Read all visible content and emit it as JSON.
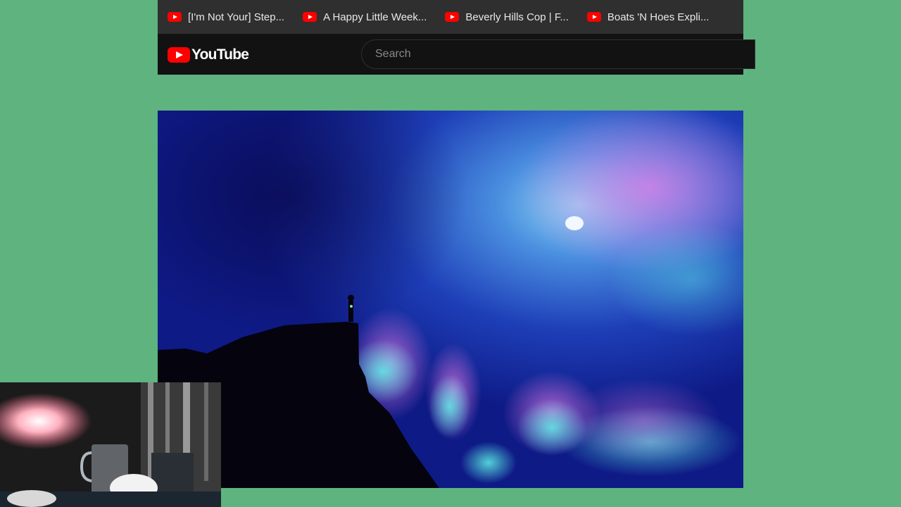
{
  "bookmarks": [
    {
      "label": "[I'm Not Your] Step...",
      "icon": "youtube-icon"
    },
    {
      "label": "A Happy Little Week...",
      "icon": "youtube-icon"
    },
    {
      "label": "Beverly Hills Cop | F...",
      "icon": "youtube-icon"
    },
    {
      "label": "Boats 'N Hoes Expli...",
      "icon": "youtube-icon"
    }
  ],
  "header": {
    "logo_text": "YouTube",
    "search_placeholder": "Search"
  },
  "colors": {
    "page_background": "#5fb37f",
    "bookmarks_bar": "#2f2f2f",
    "header_background": "#121212",
    "brand_red": "#ff0000"
  }
}
